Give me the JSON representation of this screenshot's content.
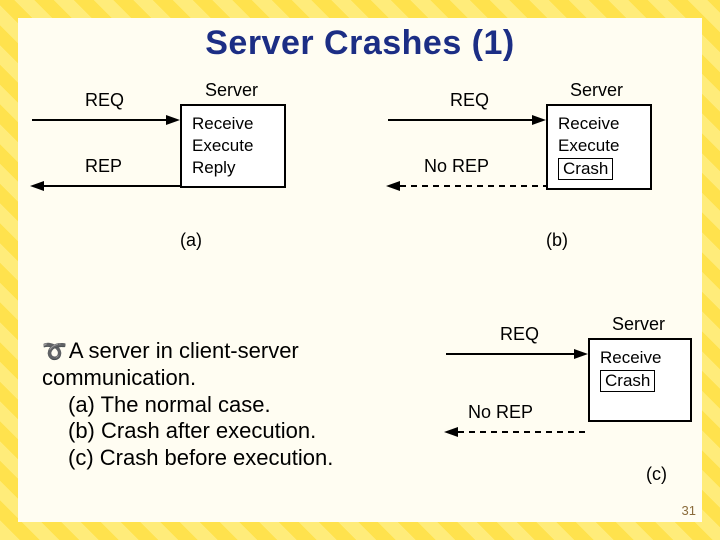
{
  "title": "Server Crashes (1)",
  "diagrams": {
    "a": {
      "server_label": "Server",
      "req": "REQ",
      "rep": "REP",
      "rows": [
        "Receive",
        "Execute",
        "Reply"
      ],
      "sublabel": "(a)"
    },
    "b": {
      "server_label": "Server",
      "req": "REQ",
      "norep": "No REP",
      "rows": [
        "Receive",
        "Execute"
      ],
      "crash": "Crash",
      "sublabel": "(b)"
    },
    "c": {
      "server_label": "Server",
      "req": "REQ",
      "norep": "No REP",
      "rows": [
        "Receive"
      ],
      "crash": "Crash",
      "sublabel": "(c)"
    }
  },
  "body": {
    "lead": "A server in client-server communication.",
    "a": "(a) The normal case.",
    "b": "(b) Crash after execution.",
    "c": "(c) Crash before execution."
  },
  "page_number": "31"
}
